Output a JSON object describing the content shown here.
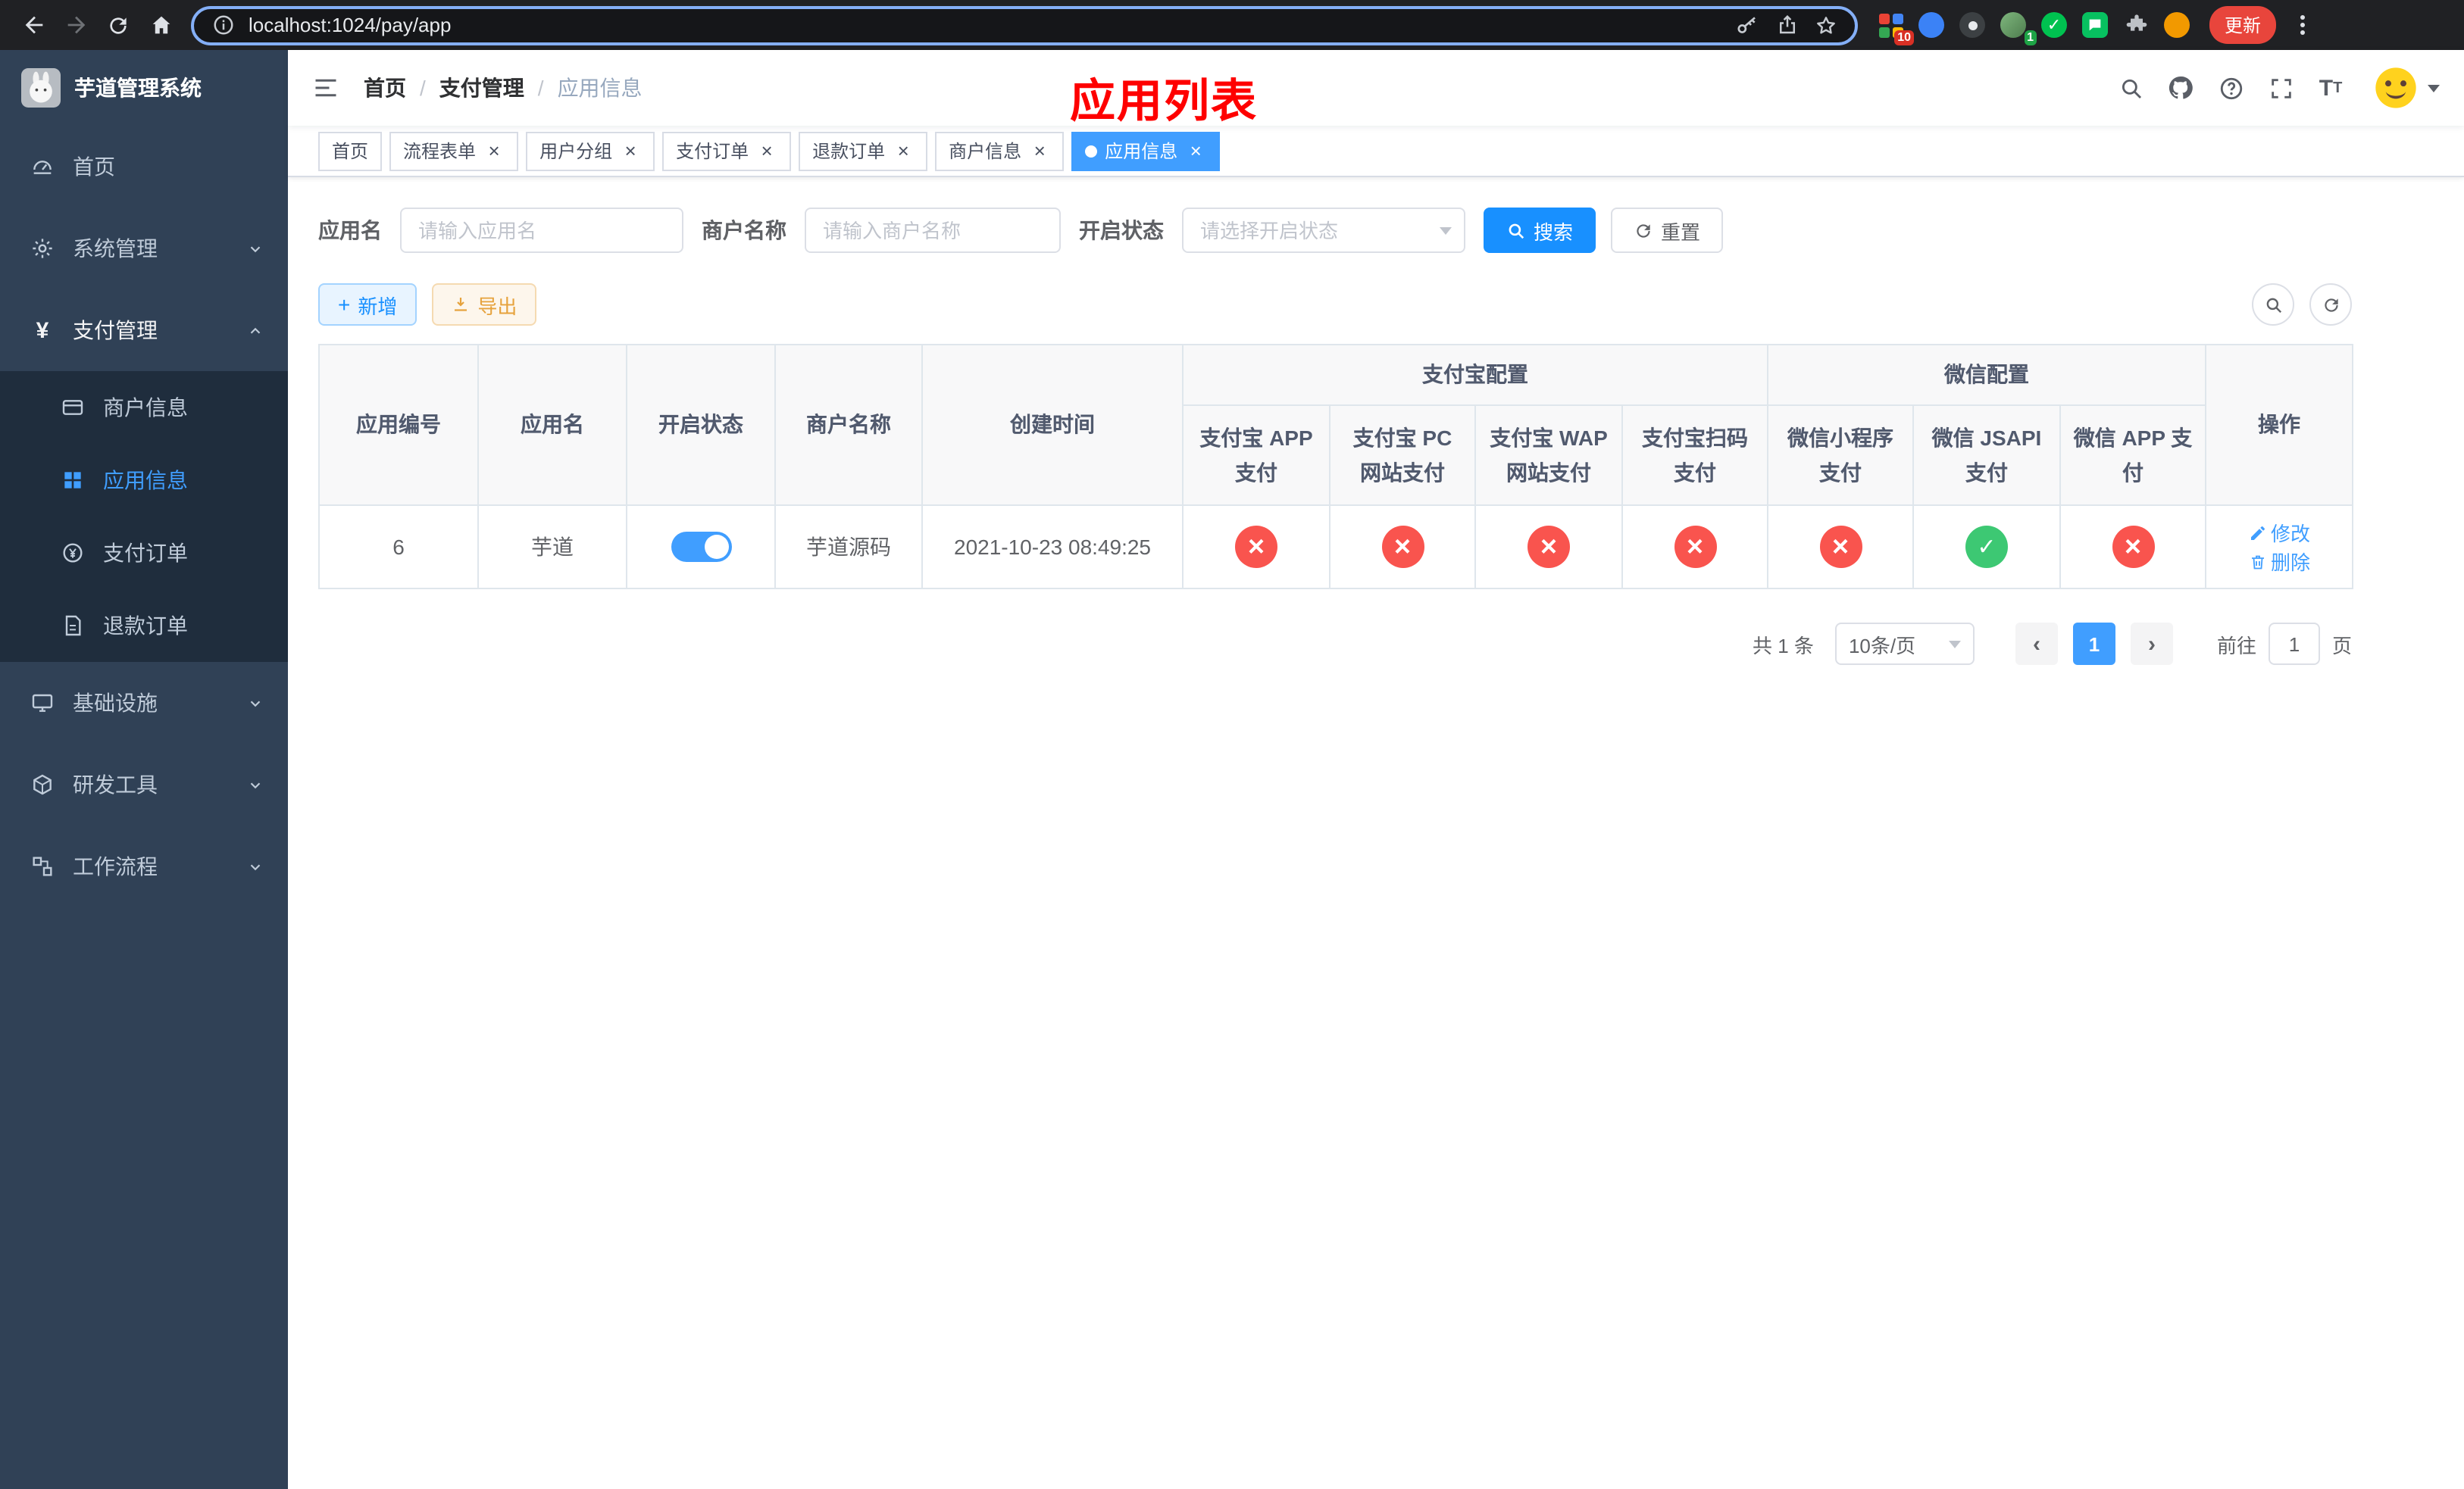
{
  "browser": {
    "url": "localhost:1024/pay/app",
    "update_button": "更新",
    "extensions_badge": "10",
    "avatar_badge": "1"
  },
  "sidebar": {
    "title": "芋道管理系统",
    "menu": [
      {
        "label": "首页"
      },
      {
        "label": "系统管理"
      },
      {
        "label": "支付管理"
      },
      {
        "label": "商户信息"
      },
      {
        "label": "应用信息"
      },
      {
        "label": "支付订单"
      },
      {
        "label": "退款订单"
      },
      {
        "label": "基础设施"
      },
      {
        "label": "研发工具"
      },
      {
        "label": "工作流程"
      }
    ]
  },
  "breadcrumb": {
    "items": [
      "首页",
      "支付管理",
      "应用信息"
    ]
  },
  "annotation": {
    "title": "应用列表"
  },
  "tags": [
    {
      "label": "首页"
    },
    {
      "label": "流程表单"
    },
    {
      "label": "用户分组"
    },
    {
      "label": "支付订单"
    },
    {
      "label": "退款订单"
    },
    {
      "label": "商户信息"
    },
    {
      "label": "应用信息"
    }
  ],
  "filters": {
    "app_name_label": "应用名",
    "app_name_placeholder": "请输入应用名",
    "merchant_label": "商户名称",
    "merchant_placeholder": "请输入商户名称",
    "status_label": "开启状态",
    "status_placeholder": "请选择开启状态",
    "search_button": "搜索",
    "reset_button": "重置"
  },
  "toolbar": {
    "add_button": "新增",
    "export_button": "导出"
  },
  "table": {
    "headers": {
      "app_id": "应用编号",
      "app_name": "应用名",
      "status": "开启状态",
      "merchant": "商户名称",
      "create_time": "创建时间",
      "alipay_group": "支付宝配置",
      "wechat_group": "微信配置",
      "actions": "操作",
      "alipay_app": "支付宝 APP 支付",
      "alipay_pc": "支付宝 PC 网站支付",
      "alipay_wap": "支付宝 WAP 网站支付",
      "alipay_qr": "支付宝扫码支付",
      "wx_mini": "微信小程序支付",
      "wx_jsapi": "微信 JSAPI 支付",
      "wx_app": "微信 APP 支付"
    },
    "rows": [
      {
        "app_id": "6",
        "app_name": "芋道",
        "status": "on",
        "merchant": "芋道源码",
        "create_time": "2021-10-23 08:49:25",
        "configs": [
          "no",
          "no",
          "no",
          "no",
          "no",
          "yes",
          "no"
        ],
        "edit_label": "修改",
        "delete_label": "删除"
      }
    ]
  },
  "pagination": {
    "total": "共 1 条",
    "page_size": "10条/页",
    "current_page": "1",
    "goto_label": "前往",
    "goto_value": "1",
    "page_unit": "页"
  }
}
